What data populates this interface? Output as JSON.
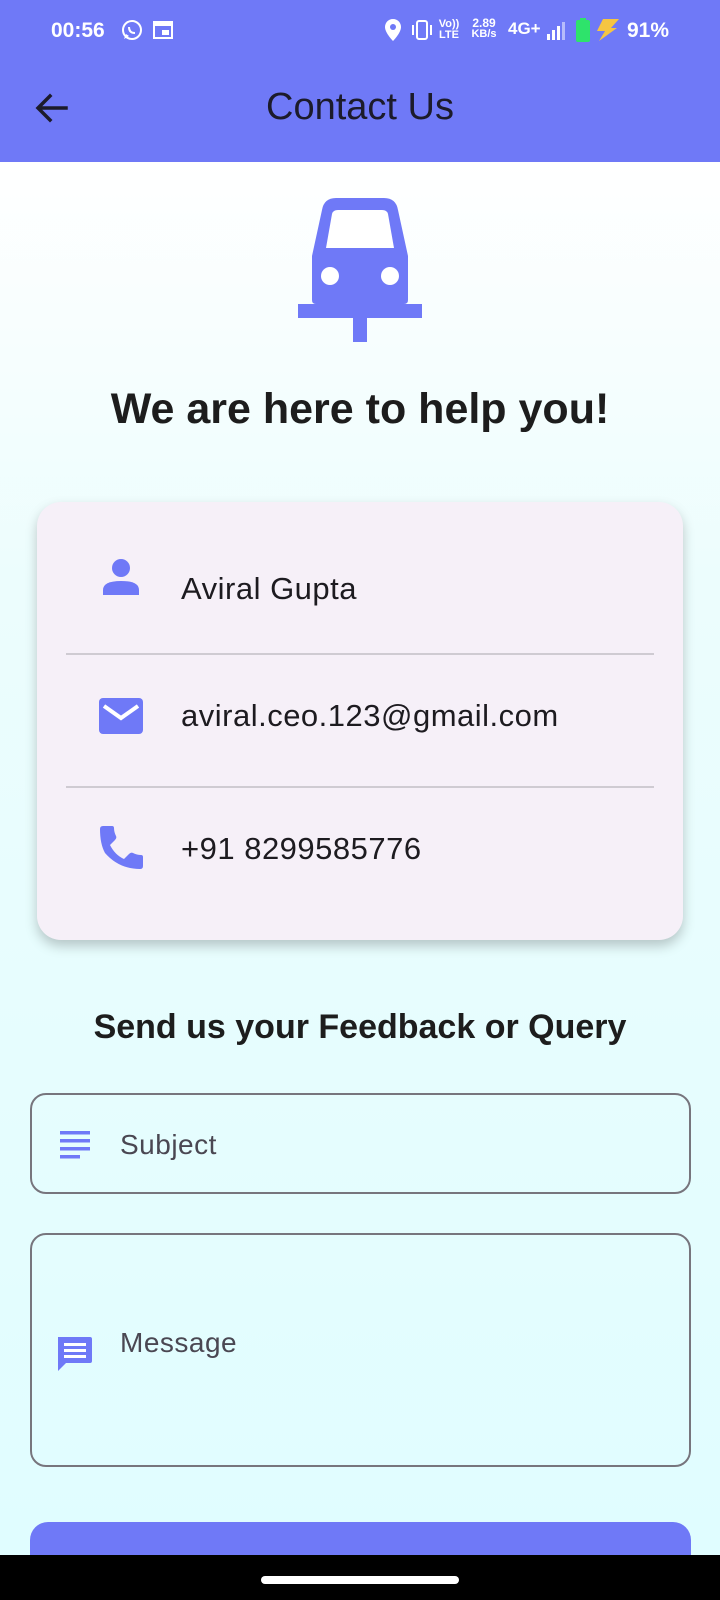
{
  "status_bar": {
    "time": "00:56",
    "volte_top": "Vo))",
    "volte_bottom": "LTE",
    "speed_value": "2.89",
    "speed_unit": "KB/s",
    "network": "4G+",
    "battery_percent": "91%"
  },
  "app_bar": {
    "title": "Contact Us",
    "back_icon": "arrow-back-icon"
  },
  "headline": "We are here to help you!",
  "contact_card": {
    "items": [
      {
        "icon": "person-icon",
        "text": "Aviral Gupta"
      },
      {
        "icon": "mail-icon",
        "text": "aviral.ceo.123@gmail.com"
      },
      {
        "icon": "phone-icon",
        "text": "+91 8299585776"
      }
    ]
  },
  "feedback": {
    "title": "Send us your Feedback or Query",
    "subject_placeholder": "Subject",
    "message_placeholder": "Message"
  },
  "colors": {
    "primary": "#6f79f7",
    "background": "#e0fdff",
    "card": "#f6f0f8",
    "text": "#1d1b20"
  }
}
